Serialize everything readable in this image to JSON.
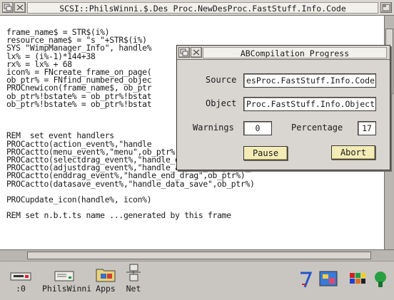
{
  "editor": {
    "title": "SCSI::PhilsWinni.$.Des_Proc.NewDesProc.FastStuff.Info.Code",
    "code_lines": [
      "frame_name$ = STR$(i%)",
      "resource_name$ = \"s_\"+STR$(i%)",
      "SYS \"WimpManager_Info\", handle%",
      "lx% = (i%-1)*144+38",
      "rx% = lx% + 68",
      "icon% = FNcreate_frame_on_page(",
      "ob_ptr% = FNfind_numbered_objec",
      "PROCnewicon(frame_name$, ob_ptr",
      "ob_ptr%!bstate% = ob_ptr%!bstat",
      "ob_ptr%!bstate% = ob_ptr%!bstat",
      "",
      "",
      "",
      "REM  set event handlers",
      "PROCactto(action_event%,\"handle",
      "PROCactto(menu_event%,\"menu\",ob_ptr%)",
      "PROCactto(selectdrag_event%,\"handle_drag\",ob_ptr%)",
      "PROCactto(adjustdrag_event%,\"handle_adjust_drag\",ob_ptr%)",
      "PROCactto(enddrag_event%,\"handle_end_drag\",ob_ptr%)",
      "PROCactto(datasave_event%,\"handle_data_save\",ob_ptr%)",
      "",
      "PROCupdate_icon(handle%, icon%)",
      "",
      "REM set n.b.t.ts name ...generated by this frame"
    ]
  },
  "dialog": {
    "title": "ABCompilation Progress",
    "source_label": "Source",
    "source_value": "esProc.FastStuff.Info.Code",
    "object_label": "Object",
    "object_value": "Proc.FastStuff.Info.Object",
    "warnings_label": "Warnings",
    "warnings_value": "0",
    "percentage_label": "Percentage",
    "percentage_value": "17",
    "pause_label": "Pause",
    "abort_label": "Abort"
  },
  "iconbar": {
    "drive_label": ":0",
    "disc_label": "PhilsWinni",
    "apps_label": "Apps",
    "net_label": "Net"
  },
  "icons": [
    "back-icon",
    "iconise-icon",
    "toggle-size-icon",
    "floppy-drive-icon",
    "hard-disc-icon",
    "apps-folder-icon",
    "network-icon",
    "paint-icon",
    "display-icon",
    "palette-icon",
    "task-manager-icon"
  ],
  "colors": {
    "window_grey": "#d9d6d2",
    "button_cream": "#f4ecb6",
    "field_white": "#ffffff"
  }
}
